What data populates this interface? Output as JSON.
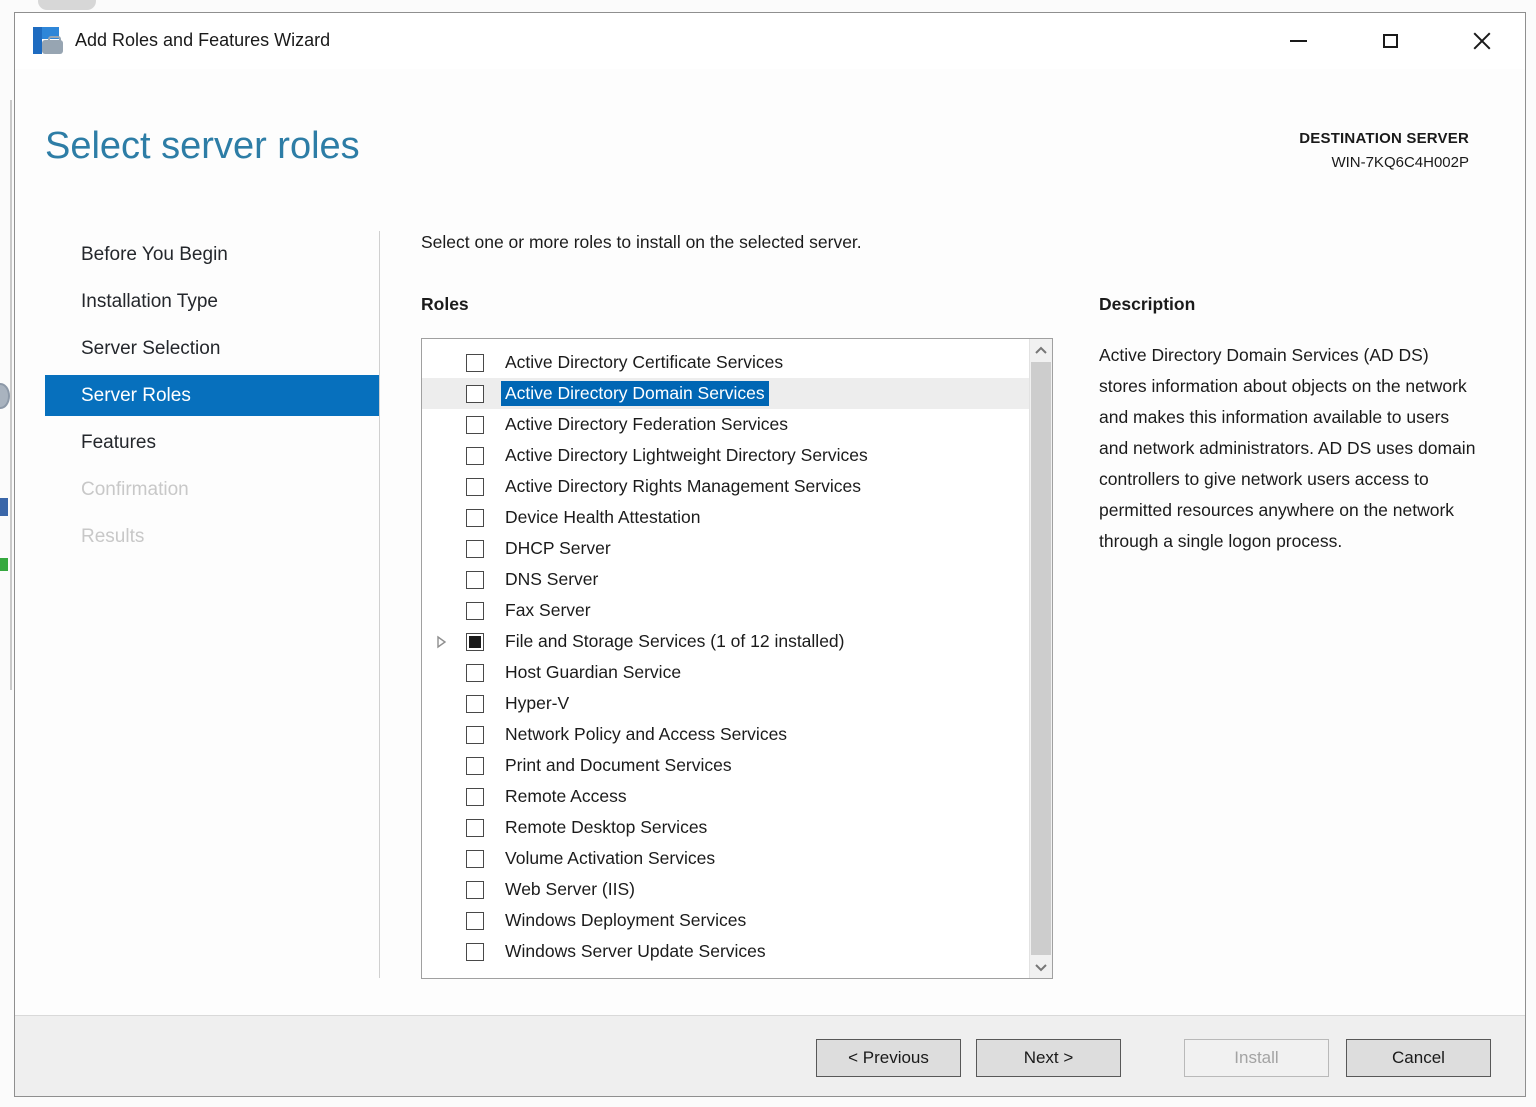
{
  "window": {
    "title": "Add Roles and Features Wizard"
  },
  "header": {
    "title": "Select server roles",
    "destination_label": "DESTINATION SERVER",
    "destination_server": "WIN-7KQ6C4H002P"
  },
  "sidebar": {
    "items": [
      {
        "label": "Before You Begin",
        "state": "enabled"
      },
      {
        "label": "Installation Type",
        "state": "enabled"
      },
      {
        "label": "Server Selection",
        "state": "enabled"
      },
      {
        "label": "Server Roles",
        "state": "selected"
      },
      {
        "label": "Features",
        "state": "enabled"
      },
      {
        "label": "Confirmation",
        "state": "disabled"
      },
      {
        "label": "Results",
        "state": "disabled"
      }
    ]
  },
  "main": {
    "instruction": "Select one or more roles to install on the selected server.",
    "roles_label": "Roles",
    "roles": [
      {
        "label": "Active Directory Certificate Services",
        "checkbox": "unchecked",
        "selected": false,
        "expandable": false
      },
      {
        "label": "Active Directory Domain Services",
        "checkbox": "unchecked",
        "selected": true,
        "expandable": false
      },
      {
        "label": "Active Directory Federation Services",
        "checkbox": "unchecked",
        "selected": false,
        "expandable": false
      },
      {
        "label": "Active Directory Lightweight Directory Services",
        "checkbox": "unchecked",
        "selected": false,
        "expandable": false
      },
      {
        "label": "Active Directory Rights Management Services",
        "checkbox": "unchecked",
        "selected": false,
        "expandable": false
      },
      {
        "label": "Device Health Attestation",
        "checkbox": "unchecked",
        "selected": false,
        "expandable": false
      },
      {
        "label": "DHCP Server",
        "checkbox": "unchecked",
        "selected": false,
        "expandable": false
      },
      {
        "label": "DNS Server",
        "checkbox": "unchecked",
        "selected": false,
        "expandable": false
      },
      {
        "label": "Fax Server",
        "checkbox": "unchecked",
        "selected": false,
        "expandable": false
      },
      {
        "label": "File and Storage Services (1 of 12 installed)",
        "checkbox": "partial",
        "selected": false,
        "expandable": true
      },
      {
        "label": "Host Guardian Service",
        "checkbox": "unchecked",
        "selected": false,
        "expandable": false
      },
      {
        "label": "Hyper-V",
        "checkbox": "unchecked",
        "selected": false,
        "expandable": false
      },
      {
        "label": "Network Policy and Access Services",
        "checkbox": "unchecked",
        "selected": false,
        "expandable": false
      },
      {
        "label": "Print and Document Services",
        "checkbox": "unchecked",
        "selected": false,
        "expandable": false
      },
      {
        "label": "Remote Access",
        "checkbox": "unchecked",
        "selected": false,
        "expandable": false
      },
      {
        "label": "Remote Desktop Services",
        "checkbox": "unchecked",
        "selected": false,
        "expandable": false
      },
      {
        "label": "Volume Activation Services",
        "checkbox": "unchecked",
        "selected": false,
        "expandable": false
      },
      {
        "label": "Web Server (IIS)",
        "checkbox": "unchecked",
        "selected": false,
        "expandable": false
      },
      {
        "label": "Windows Deployment Services",
        "checkbox": "unchecked",
        "selected": false,
        "expandable": false
      },
      {
        "label": "Windows Server Update Services",
        "checkbox": "unchecked",
        "selected": false,
        "expandable": false
      }
    ]
  },
  "description": {
    "heading": "Description",
    "text": "Active Directory Domain Services (AD DS) stores information about objects on the network and makes this information available to users and network administrators. AD DS uses domain controllers to give network users access to permitted resources anywhere on the network through a single logon process."
  },
  "footer": {
    "previous": "< Previous",
    "next": "Next >",
    "install": "Install",
    "cancel": "Cancel"
  },
  "colors": {
    "heading_blue": "#2d7da6",
    "sidebar_selected_blue": "#0770bd",
    "list_highlight_blue": "#0066b4",
    "footer_gray": "#efefef",
    "disabled_text": "#c8c8c8"
  }
}
